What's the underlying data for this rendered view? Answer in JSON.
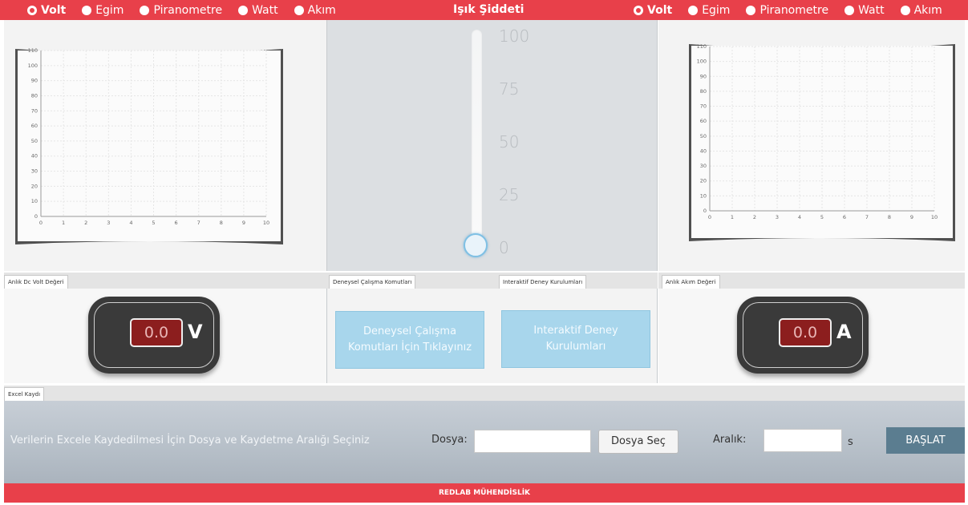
{
  "topbar": {
    "left_options": [
      {
        "label": "Volt",
        "selected": true
      },
      {
        "label": "Egim",
        "selected": false
      },
      {
        "label": "Piranometre",
        "selected": false
      },
      {
        "label": "Watt",
        "selected": false
      },
      {
        "label": "Akım",
        "selected": false
      }
    ],
    "title": "Işık Şiddeti",
    "right_options": [
      {
        "label": "Volt",
        "selected": true
      },
      {
        "label": "Egim",
        "selected": false
      },
      {
        "label": "Piranometre",
        "selected": false
      },
      {
        "label": "Watt",
        "selected": false
      },
      {
        "label": "Akım",
        "selected": false
      }
    ]
  },
  "chart_data": [
    {
      "type": "line",
      "x": [],
      "series": [],
      "x_ticks": [
        "0",
        "1",
        "2",
        "3",
        "4",
        "5",
        "6",
        "7",
        "8",
        "9",
        "10"
      ],
      "y_ticks": [
        "0",
        "10",
        "20",
        "30",
        "40",
        "50",
        "60",
        "70",
        "80",
        "90",
        "100",
        "110"
      ],
      "xlim": [
        0,
        10
      ],
      "ylim": [
        0,
        110
      ],
      "grid": true
    },
    {
      "type": "line",
      "x": [],
      "series": [],
      "x_ticks": [
        "0",
        "1",
        "2",
        "3",
        "4",
        "5",
        "6",
        "7",
        "8",
        "9",
        "10"
      ],
      "y_ticks": [
        "0",
        "10",
        "20",
        "30",
        "40",
        "50",
        "60",
        "70",
        "80",
        "90",
        "100",
        "110"
      ],
      "xlim": [
        0,
        10
      ],
      "ylim": [
        0,
        110
      ],
      "grid": true
    }
  ],
  "slider": {
    "ticks": [
      "100",
      "75",
      "50",
      "25",
      "0"
    ],
    "value": 0,
    "min": 0,
    "max": 100
  },
  "tabs": {
    "volt": "Anlık Dc Volt Değeri",
    "commands": "Deneysel Çalışma Komutları",
    "interactive": "Interaktif Deney Kurulumları",
    "current": "Anlık Akım Değeri",
    "excel": "Excel Kaydı"
  },
  "meters": {
    "volt": {
      "value": "0.0",
      "unit": "V"
    },
    "current": {
      "value": "0.0",
      "unit": "A"
    }
  },
  "commands": {
    "experiment_button": "Deneysel Çalışma Komutları İçin Tıklayınız",
    "interactive_button": "Interaktif Deney Kurulumları"
  },
  "excel": {
    "description": "Verilerin Excele Kaydedilmesi İçin Dosya ve Kaydetme Aralığı Seçiniz",
    "file_label": "Dosya:",
    "file_value": "",
    "file_button": "Dosya Seç",
    "interval_label": "Aralık:",
    "interval_value": "",
    "interval_unit": "s",
    "start_button": "BAŞLAT"
  },
  "footer": {
    "text": "REDLAB MÜHENDİSLİK"
  },
  "colors": {
    "brand_red": "#e8404a",
    "button_blue": "#a8d6ec",
    "start_button": "#5b7d90",
    "meter_display": "#8c1e1e"
  }
}
